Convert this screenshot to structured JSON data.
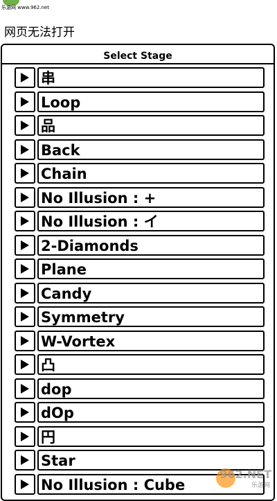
{
  "watermark_top": {
    "text": "乐游网 www.962.net"
  },
  "page": {
    "title": "网页无法打开"
  },
  "panel": {
    "header": "Select Stage"
  },
  "stages": [
    {
      "label": "串"
    },
    {
      "label": "Loop"
    },
    {
      "label": "品"
    },
    {
      "label": "Back"
    },
    {
      "label": "Chain"
    },
    {
      "label": "No Illusion : +"
    },
    {
      "label": "No Illusion : イ"
    },
    {
      "label": "2-Diamonds"
    },
    {
      "label": "Plane"
    },
    {
      "label": "Candy"
    },
    {
      "label": "Symmetry"
    },
    {
      "label": "W-Vortex"
    },
    {
      "label": "凸"
    },
    {
      "label": "dop"
    },
    {
      "label": "dOp"
    },
    {
      "label": "円"
    },
    {
      "label": "Star"
    },
    {
      "label": "No Illusion : Cube"
    }
  ],
  "watermark_bottom": {
    "text": "962.NET",
    "sub": "乐游网"
  },
  "icons": {
    "play": "play-triangle-icon"
  }
}
